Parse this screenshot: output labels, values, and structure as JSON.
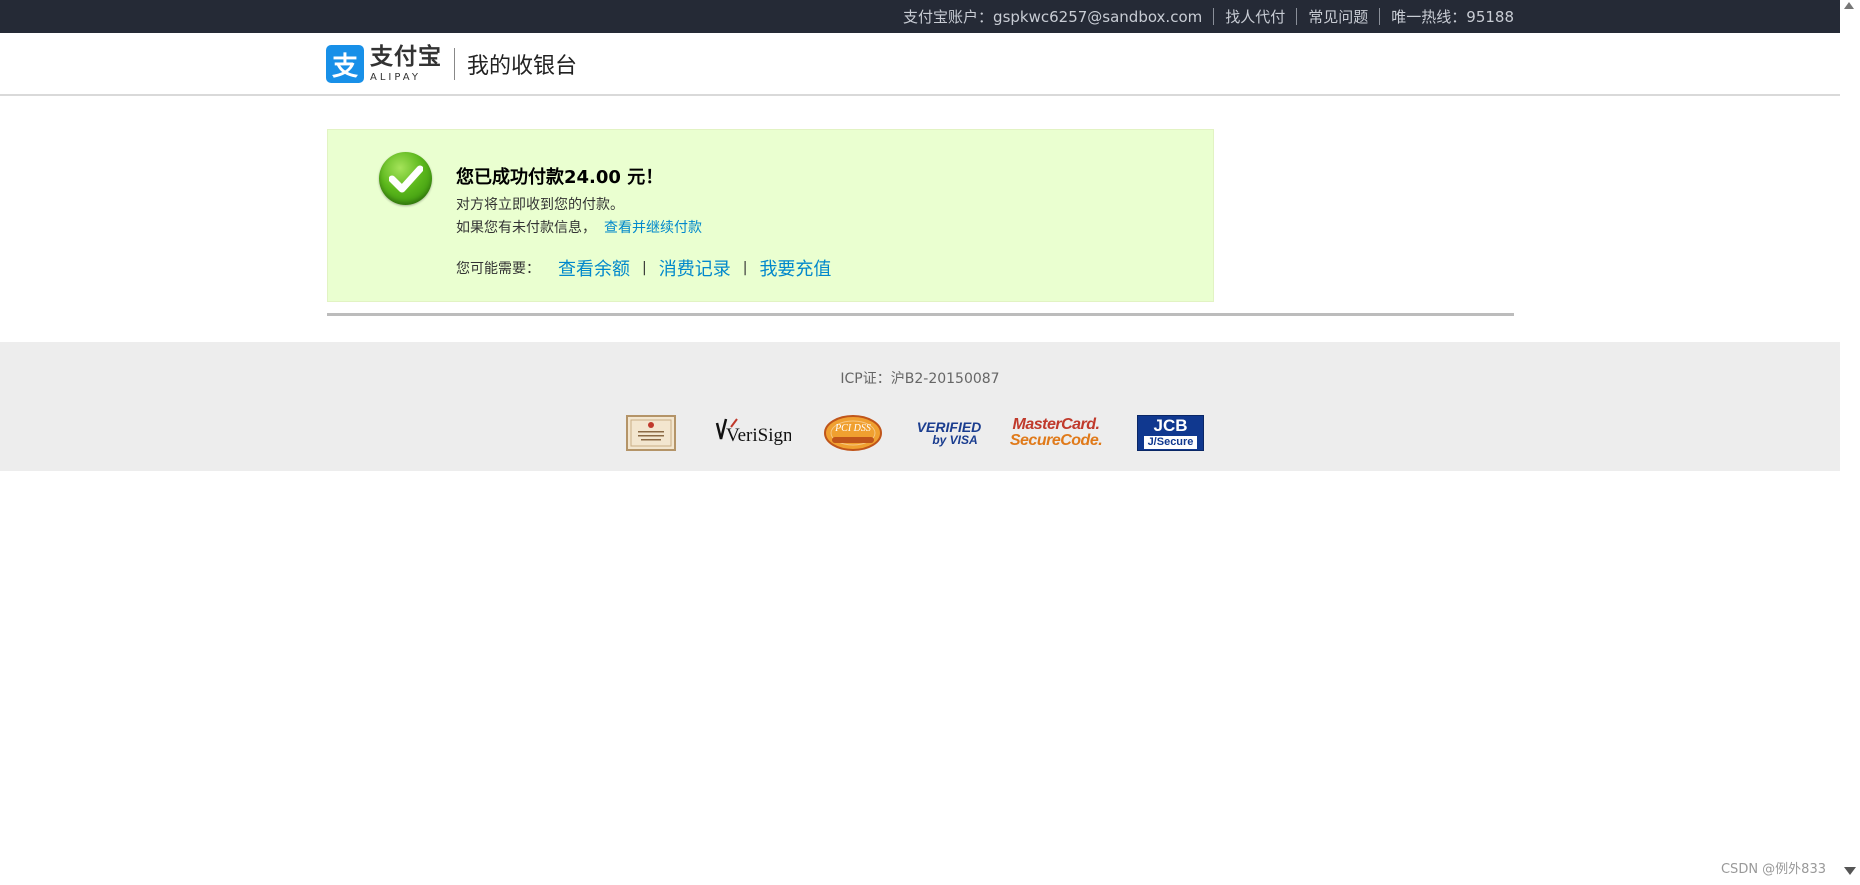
{
  "topbar": {
    "account_label": "支付宝账户：gspkwc6257@sandbox.com",
    "find_payer": "找人代付",
    "faq": "常见问题",
    "hotline": "唯一热线：95188"
  },
  "header": {
    "logo_mark": "支",
    "logo_cn": "支付宝",
    "logo_en": "ALIPAY",
    "page_title": "我的收银台"
  },
  "success": {
    "title": "您已成功付款24.00 元！",
    "line1": "对方将立即收到您的付款。",
    "line2_prefix": "如果您有未付款信息，",
    "line2_link": "查看并继续付款",
    "maybe_label": "您可能需要：",
    "links": [
      "查看余额",
      "消费记录",
      "我要充值"
    ],
    "separator": "|"
  },
  "footer": {
    "icp": "ICP证：沪B2-20150087",
    "badges": [
      "cert-badge",
      "verisign-badge",
      "pciss-badge",
      "verified-by-visa-badge",
      "mastercard-securecode-badge",
      "jcb-jsecure-badge"
    ],
    "verisign_text": "VeriSign",
    "visa_line1": "VERIFIED",
    "visa_line2": "by VISA",
    "mc_line1": "MasterCard.",
    "mc_line2": "SecureCode.",
    "jcb_line1": "JCB",
    "jcb_line2": "J/Secure",
    "pci_text": "PCI DSS"
  },
  "watermark": "CSDN @例外833",
  "colors": {
    "topbar_bg": "#252a36",
    "success_bg": "#eaffd0",
    "link": "#0088cc",
    "brand_blue": "#1890e8"
  }
}
